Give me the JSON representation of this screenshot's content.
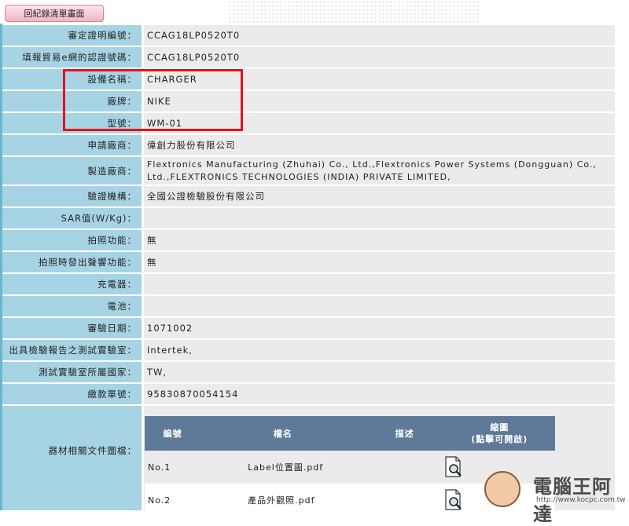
{
  "toolbar": {
    "back_label": "回紀錄清單畫面"
  },
  "record": [
    {
      "label": "審定證明編號：",
      "value": "CCAG18LP0520T0"
    },
    {
      "label": "填報貿易e網的認證號碼：",
      "value": "CCAG18LP0520T0"
    },
    {
      "label": "設備名稱：",
      "value": "CHARGER"
    },
    {
      "label": "廠牌：",
      "value": "NIKE"
    },
    {
      "label": "型號：",
      "value": "WM-01"
    },
    {
      "label": "申請廠商：",
      "value": "偉創力股份有限公司"
    },
    {
      "label": "製造廠商：",
      "value": "Flextronics Manufacturing (Zhuhai) Co., Ltd.,Flextronics Power Systems (Dongguan) Co., Ltd.,FLEXTRONICS TECHNOLOGIES (INDIA) PRIVATE LIMITED,"
    },
    {
      "label": "驗證機構：",
      "value": "全國公證檢驗股份有限公司"
    },
    {
      "label": "SAR值(W/Kg)：",
      "value": ""
    },
    {
      "label": "拍照功能：",
      "value": "無"
    },
    {
      "label": "拍照時發出聲響功能：",
      "value": "無"
    },
    {
      "label": "充電器：",
      "value": ""
    },
    {
      "label": "電池：",
      "value": ""
    },
    {
      "label": "審驗日期：",
      "value": "1071002"
    },
    {
      "label": "出具檢驗報告之測試實驗室：",
      "value": "Intertek,"
    },
    {
      "label": "測試實驗室所屬國家：",
      "value": "TW,"
    },
    {
      "label": "繳款單號：",
      "value": "95830870054154"
    }
  ],
  "files": {
    "label": "器材相關文件圖檔：",
    "headers": {
      "no": "編號",
      "name": "檔名",
      "desc": "描述",
      "thumb": "縮圖",
      "thumb_note": "(點擊可開啟)"
    },
    "rows": [
      {
        "no": "No.1",
        "name": "Label位置圖.pdf",
        "desc": "",
        "icon": "magnifier-document-icon"
      },
      {
        "no": "No.2",
        "name": "產品外觀照.pdf",
        "desc": "",
        "icon": "magnifier-document-icon"
      }
    ]
  },
  "watermark": {
    "text": "電腦王阿達",
    "url": "http://www.kocpc.com.tw"
  },
  "colors": {
    "label_bg": "#a7d4e4",
    "value_bg": "#ebebeb",
    "header_bg": "#5f7a99",
    "highlight": "#e8101a"
  }
}
